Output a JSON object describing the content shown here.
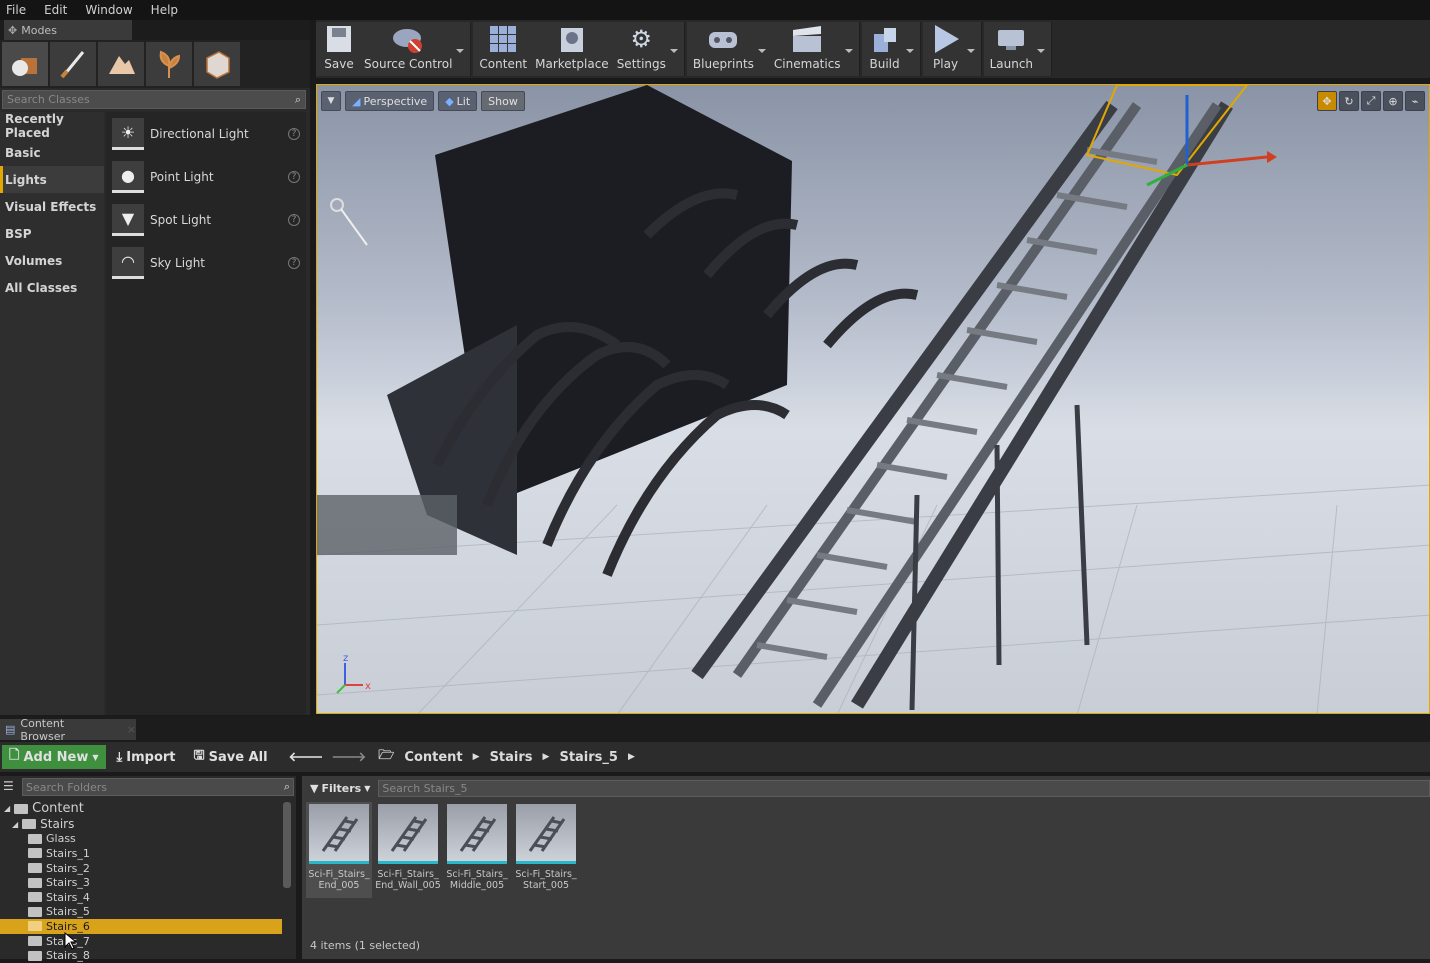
{
  "menubar": {
    "items": [
      "File",
      "Edit",
      "Window",
      "Help"
    ]
  },
  "modes": {
    "tab_label": "Modes",
    "search_placeholder": "Search Classes",
    "categories": [
      "Recently Placed",
      "Basic",
      "Lights",
      "Visual Effects",
      "BSP",
      "Volumes",
      "All Classes"
    ],
    "active_category": "Lights",
    "items": [
      "Directional Light",
      "Point Light",
      "Spot Light",
      "Sky Light"
    ]
  },
  "toolbar": {
    "buttons": [
      {
        "label": "Save",
        "icon": "save-icon"
      },
      {
        "label": "Source Control",
        "icon": "source-control-icon"
      },
      {
        "label": "Content",
        "icon": "content-icon"
      },
      {
        "label": "Marketplace",
        "icon": "marketplace-icon"
      },
      {
        "label": "Settings",
        "icon": "settings-icon"
      },
      {
        "label": "Blueprints",
        "icon": "blueprints-icon"
      },
      {
        "label": "Cinematics",
        "icon": "cinematics-icon"
      },
      {
        "label": "Build",
        "icon": "build-icon"
      },
      {
        "label": "Play",
        "icon": "play-icon"
      },
      {
        "label": "Launch",
        "icon": "launch-icon"
      }
    ]
  },
  "viewport": {
    "perspective_label": "Perspective",
    "lit_label": "Lit",
    "show_label": "Show"
  },
  "content_browser": {
    "tab_label": "Content Browser",
    "add_new_label": "Add New",
    "import_label": "Import",
    "save_all_label": "Save All",
    "breadcrumb": [
      "Content",
      "Stairs",
      "Stairs_5"
    ],
    "search_folders_placeholder": "Search Folders",
    "filters_label": "Filters",
    "search_assets_placeholder": "Search Stairs_5",
    "tree": [
      {
        "label": "Content",
        "level": 0
      },
      {
        "label": "Stairs",
        "level": 1
      },
      {
        "label": "Glass",
        "level": 2
      },
      {
        "label": "Stairs_1",
        "level": 2
      },
      {
        "label": "Stairs_2",
        "level": 2
      },
      {
        "label": "Stairs_3",
        "level": 2
      },
      {
        "label": "Stairs_4",
        "level": 2
      },
      {
        "label": "Stairs_5",
        "level": 2
      },
      {
        "label": "Stairs_6",
        "level": 2
      },
      {
        "label": "Stairs_7",
        "level": 2
      },
      {
        "label": "Stairs_8",
        "level": 2
      }
    ],
    "selected_tree_item": "Stairs_6",
    "assets": [
      "Sci-Fi_Stairs_\nEnd_005",
      "Sci-Fi_Stairs_\nEnd_Wall_005",
      "Sci-Fi_Stairs_\nMiddle_005",
      "Sci-Fi_Stairs_\nStart_005"
    ],
    "selected_asset_index": 0,
    "item_count": "4 items (1 selected)"
  },
  "colors": {
    "accent": "#e0a800",
    "add_new": "#3e8f3e",
    "asset_underline": "#27b7c9"
  }
}
